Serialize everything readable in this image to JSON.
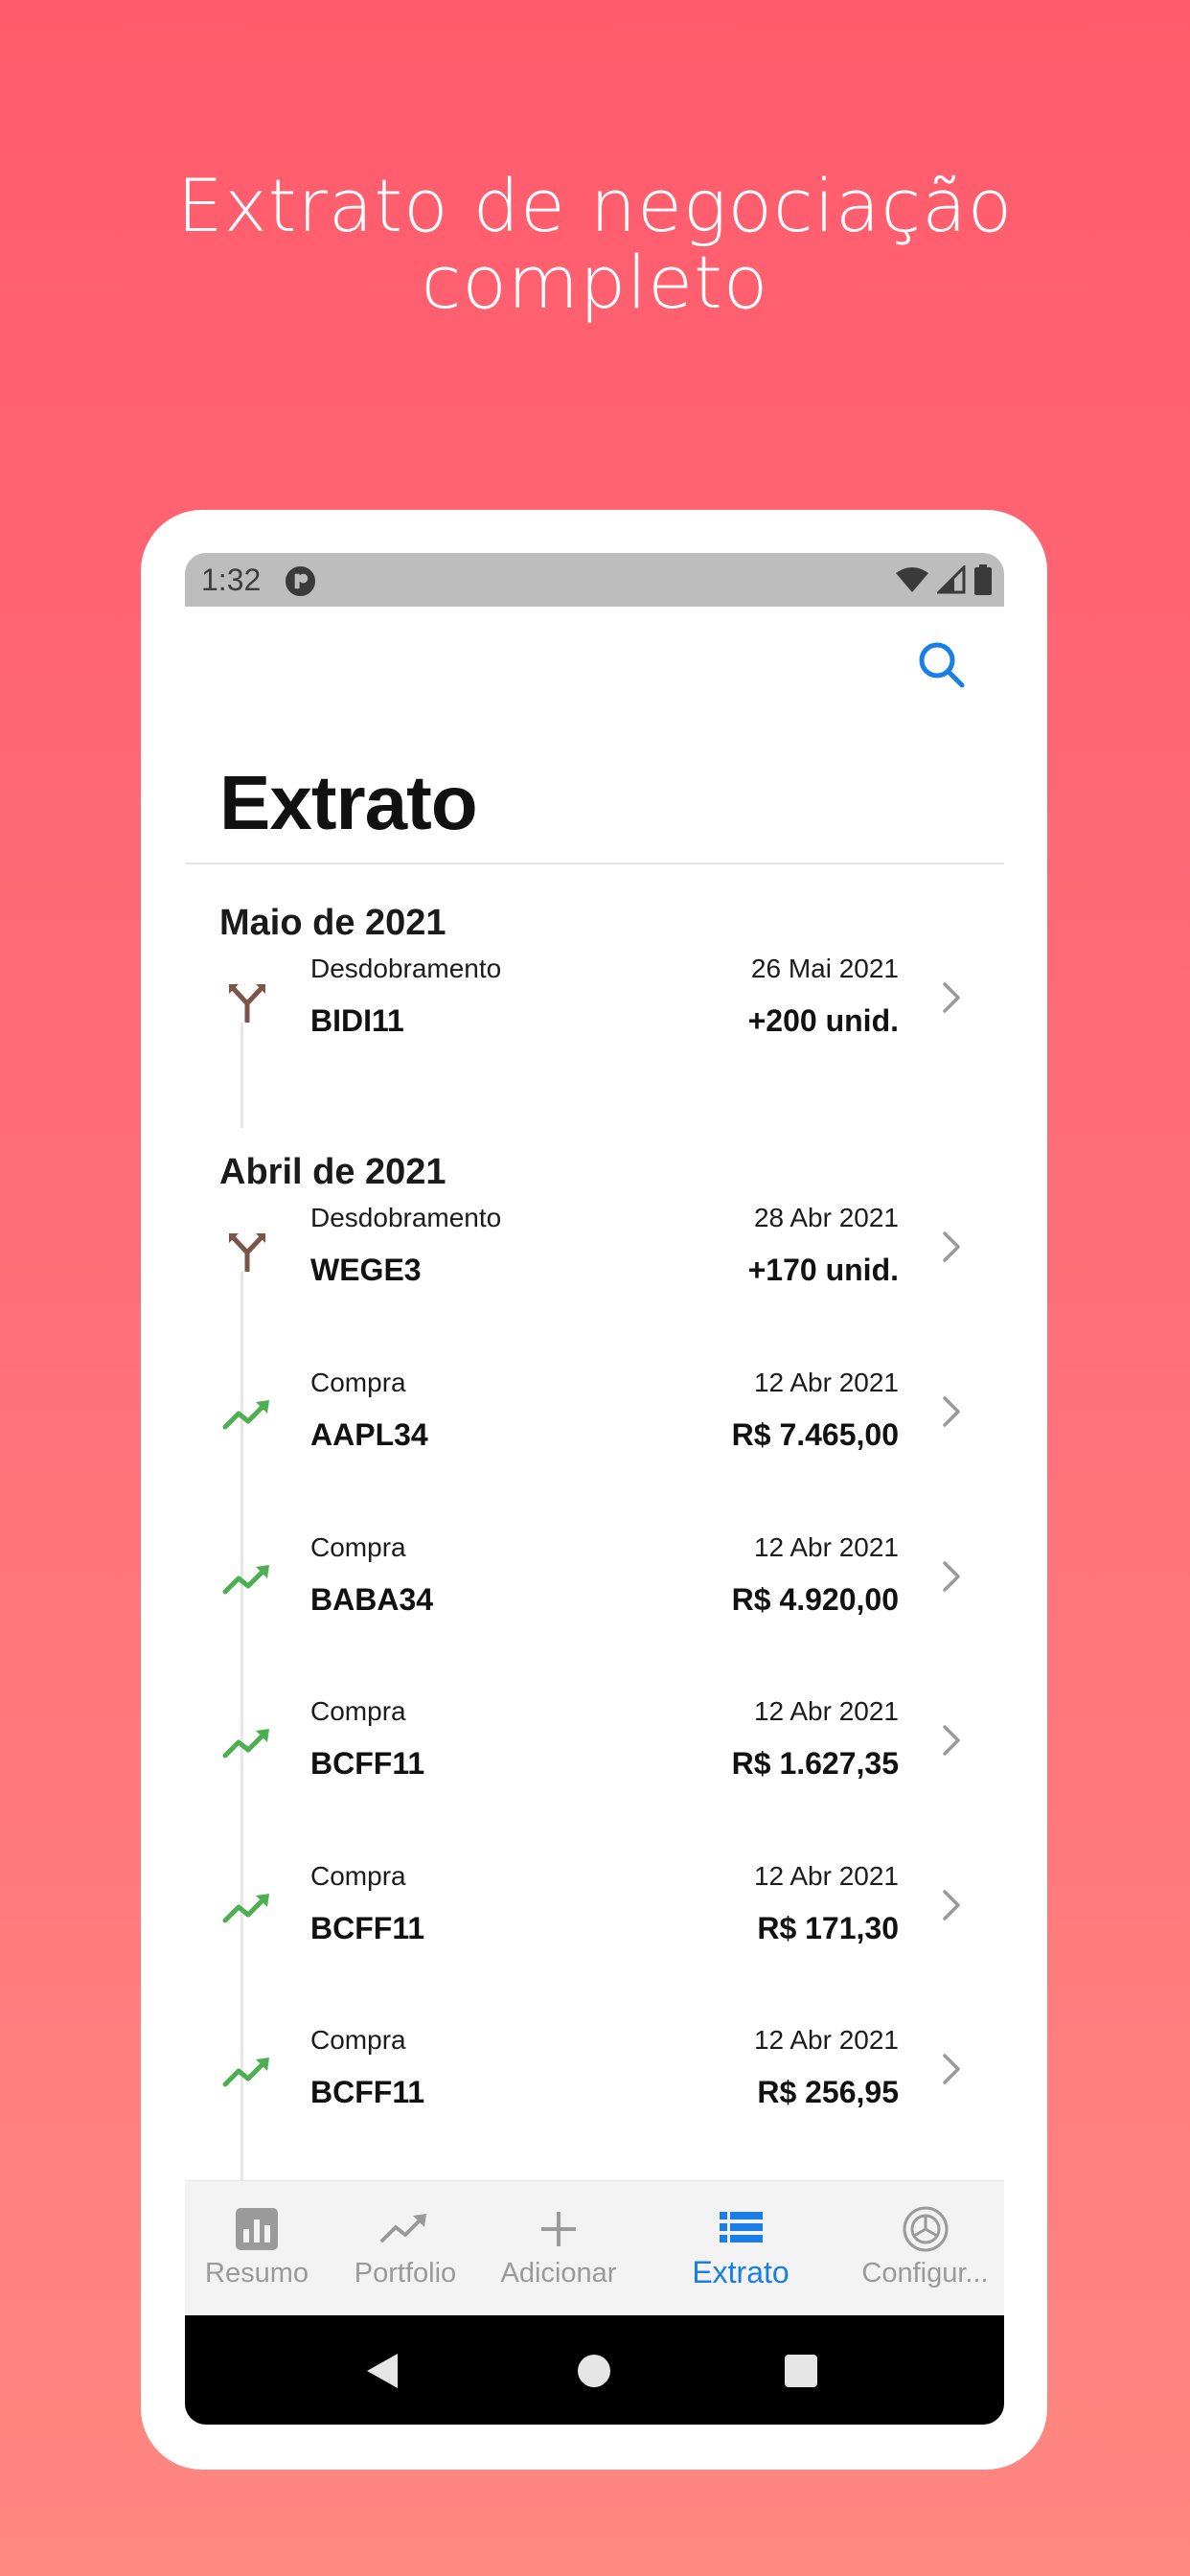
{
  "headline": {
    "line1": "Extrato de negociação",
    "line2": "completo"
  },
  "status_bar": {
    "time": "1:32"
  },
  "page_title": "Extrato",
  "sections": [
    {
      "heading": "Maio de 2021",
      "items": [
        {
          "type": "Desdobramento",
          "ticker": "BIDI11",
          "date": "26 Mai 2021",
          "amount": "+200 unid.",
          "icon": "split-icon"
        }
      ]
    },
    {
      "heading": "Abril de 2021",
      "items": [
        {
          "type": "Desdobramento",
          "ticker": "WEGE3",
          "date": "28 Abr 2021",
          "amount": "+170 unid.",
          "icon": "split-icon"
        },
        {
          "type": "Compra",
          "ticker": "AAPL34",
          "date": "12 Abr 2021",
          "amount": "R$ 7.465,00",
          "icon": "trending-up-icon"
        },
        {
          "type": "Compra",
          "ticker": "BABA34",
          "date": "12 Abr 2021",
          "amount": "R$ 4.920,00",
          "icon": "trending-up-icon"
        },
        {
          "type": "Compra",
          "ticker": "BCFF11",
          "date": "12 Abr 2021",
          "amount": "R$ 1.627,35",
          "icon": "trending-up-icon"
        },
        {
          "type": "Compra",
          "ticker": "BCFF11",
          "date": "12 Abr 2021",
          "amount": "R$ 171,30",
          "icon": "trending-up-icon"
        },
        {
          "type": "Compra",
          "ticker": "BCFF11",
          "date": "12 Abr 2021",
          "amount": "R$ 256,95",
          "icon": "trending-up-icon"
        }
      ]
    }
  ],
  "tabs": [
    {
      "label": "Resumo",
      "icon": "bar-chart-icon",
      "active": false
    },
    {
      "label": "Portfolio",
      "icon": "trending-up-icon",
      "active": false
    },
    {
      "label": "Adicionar",
      "icon": "plus-icon",
      "active": false
    },
    {
      "label": "Extrato",
      "icon": "list-icon",
      "active": true
    },
    {
      "label": "Configur...",
      "icon": "gear-icon",
      "active": false
    }
  ],
  "colors": {
    "background_top": "#ff5b6c",
    "background_bottom": "#ff8880",
    "accent": "#1a7ee8",
    "buy_green": "#4caf50",
    "split_brown": "#7a5548",
    "inactive_tab": "#9a9a9a"
  }
}
